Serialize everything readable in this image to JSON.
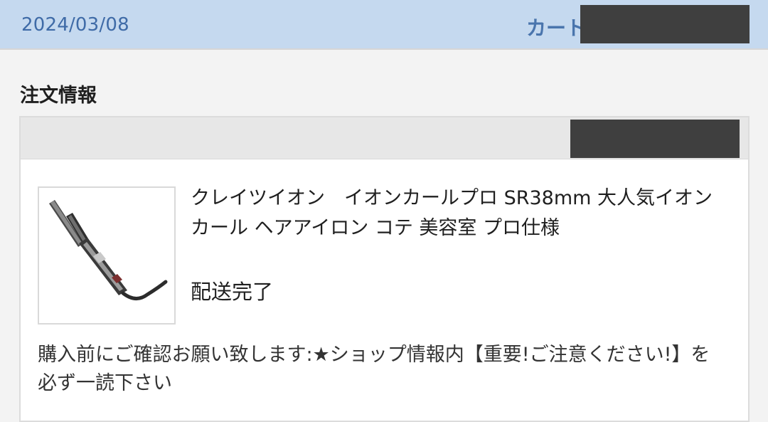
{
  "header": {
    "date": "2024/03/08",
    "cart_label": "カート"
  },
  "order_info": {
    "title": "注文情報",
    "product_name": "クレイツイオン　イオンカールプロ SR38mm 大人気イオン カール ヘアアイロン コテ 美容室 プロ仕様",
    "status": "配送完了",
    "notice": "購入前にご確認お願い致します:★ショップ情報内【重要!ご注意ください!】を必ず一読下さい"
  },
  "colors": {
    "header_bg": "#c5d9ef",
    "date_text": "#3f6ba7",
    "redaction": "#3f3f3f"
  },
  "icons": {
    "product_thumbnail": "curling-iron-image"
  }
}
